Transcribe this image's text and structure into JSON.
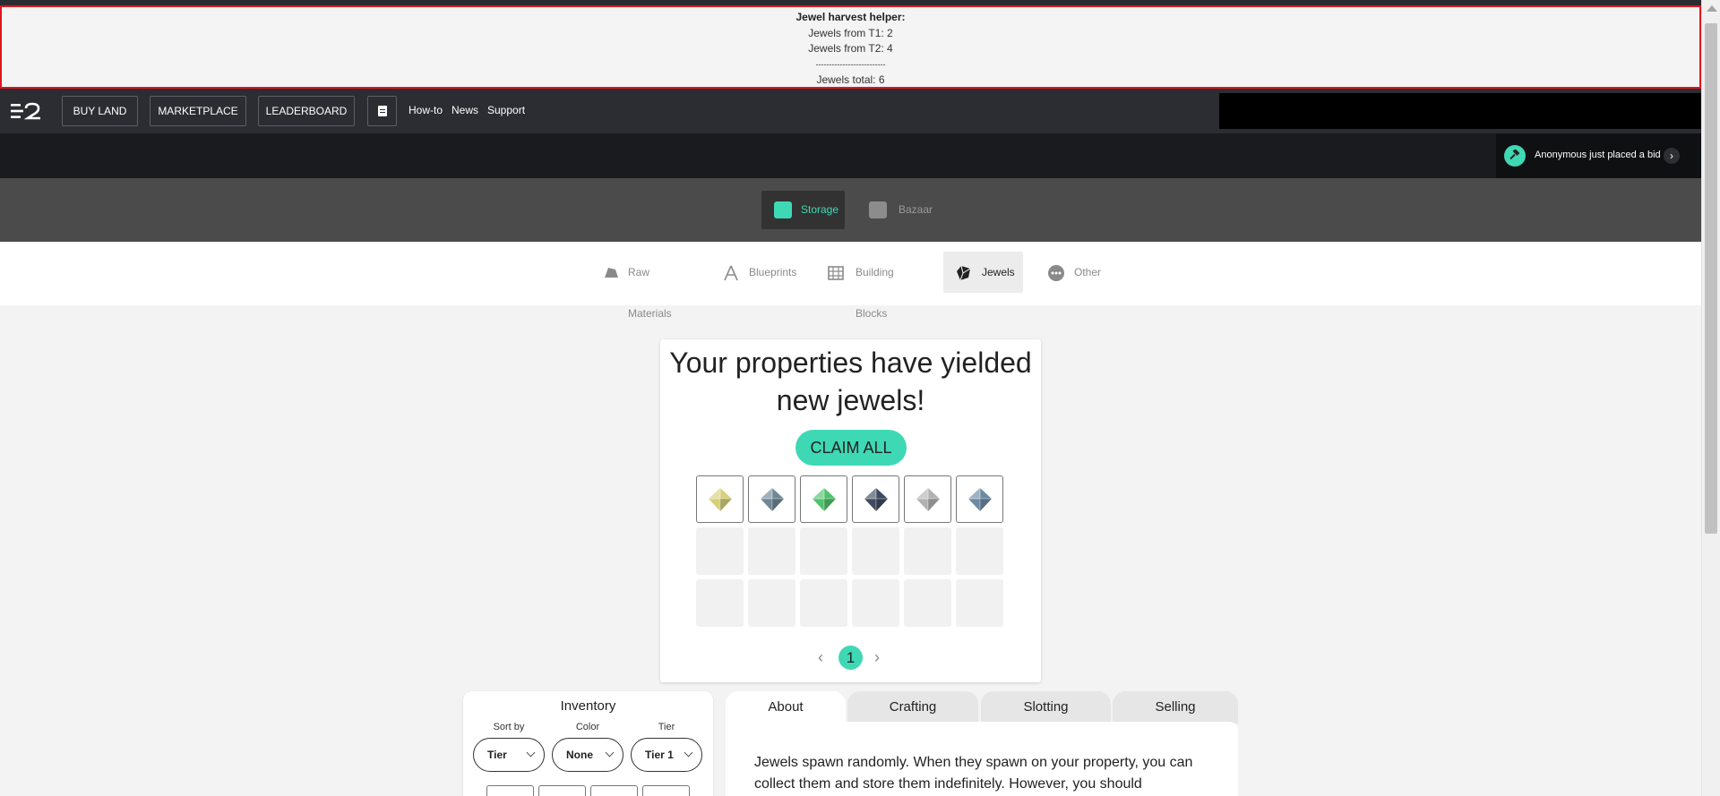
{
  "helper": {
    "title": "Jewel harvest helper:",
    "t1": "Jewels from T1: 2",
    "t2": "Jewels from T2: 4",
    "divider": "--------------------------",
    "total": "Jewels total: 6"
  },
  "nav": {
    "buy_land": "BUY LAND",
    "marketplace": "MARKETPLACE",
    "leaderboard": "LEADERBOARD",
    "howto": "How-to",
    "news": "News",
    "support": "Support"
  },
  "ticker": {
    "message": "Anonymous just placed a bid",
    "arrow": "›"
  },
  "modes": {
    "storage": "Storage",
    "bazaar": "Bazaar"
  },
  "categories": {
    "raw": "Raw Materials",
    "blueprints": "Blueprints",
    "building_blocks": "Building Blocks",
    "jewels": "Jewels",
    "other": "Other"
  },
  "claim": {
    "title": "Your properties have yielded new jewels!",
    "button": "CLAIM ALL",
    "jewel_colors": [
      "#d6d07a",
      "#6f8796",
      "#4fc36c",
      "#3e4a5f",
      "#b2b2b2",
      "#6d8aa4"
    ],
    "page": "1",
    "prev": "‹",
    "next": "›"
  },
  "inventory": {
    "title": "Inventory",
    "sort_label": "Sort by",
    "sort_value": "Tier",
    "color_label": "Color",
    "color_value": "None",
    "tier_label": "Tier",
    "tier_value": "Tier 1"
  },
  "info_tabs": {
    "about": "About",
    "crafting": "Crafting",
    "slotting": "Slotting",
    "selling": "Selling"
  },
  "about": {
    "text": "Jewels spawn randomly. When they spawn on your property, you can collect them and store them indefinitely. However, you should"
  },
  "colors": {
    "accent": "#3fd8b4",
    "nav_bg": "#2c2d32",
    "helper_border": "#e0161f"
  }
}
